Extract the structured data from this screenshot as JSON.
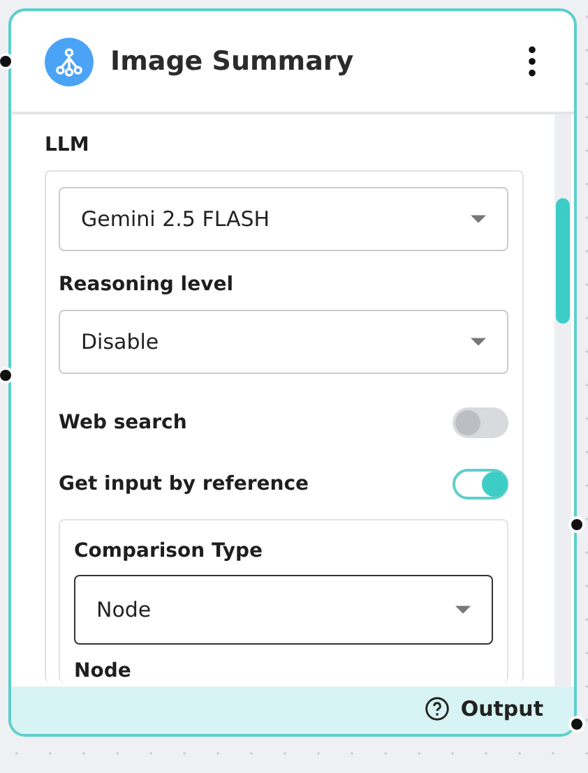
{
  "node": {
    "title": "Image Summary"
  },
  "fields": [
    {
      "kind": "select",
      "label": "LLM",
      "value": "Gemini 2.5 FLASH"
    },
    {
      "kind": "select",
      "label": "Reasoning level",
      "value": "Disable"
    },
    {
      "kind": "toggle",
      "label": "Web search",
      "on": false
    },
    {
      "kind": "toggle",
      "label": "Get input by reference",
      "on": true
    }
  ],
  "reference": {
    "label": "Comparison Type",
    "value": "Node",
    "next_label": "Node"
  },
  "footer": {
    "output": "Output"
  }
}
